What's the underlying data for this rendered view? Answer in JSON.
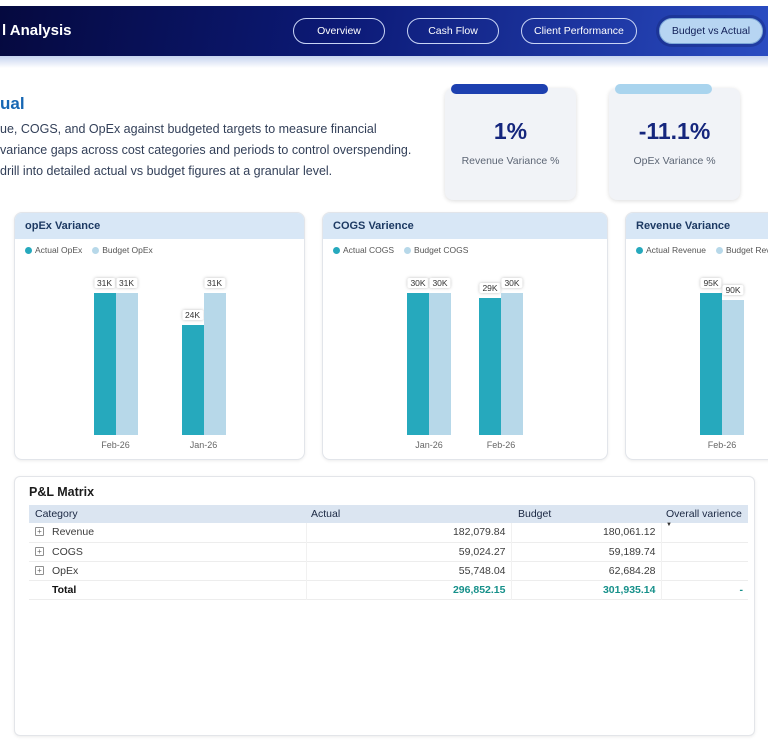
{
  "header": {
    "title": "l Analysis",
    "tabs": [
      {
        "label": "Overview",
        "active": false
      },
      {
        "label": "Cash Flow",
        "active": false
      },
      {
        "label": "Client Performance",
        "active": false
      },
      {
        "label": "Budget vs Actual",
        "active": true
      }
    ]
  },
  "intro": {
    "heading": "ual",
    "lines": [
      "ue, COGS, and OpEx against budgeted targets to measure financial",
      "variance gaps across cost categories and periods to control overspending.",
      "drill into detailed actual vs budget figures at a granular level."
    ]
  },
  "kpis": [
    {
      "value": "1%",
      "label": "Revenue Variance %",
      "accent": "#1d40b0"
    },
    {
      "value": "-11.1%",
      "label": "OpEx Variance %",
      "accent": "#a9d4ee"
    }
  ],
  "chart_data": [
    {
      "type": "bar",
      "title": "opEx Variance",
      "categories": [
        "Feb-26",
        "Jan-26"
      ],
      "series": [
        {
          "name": "Actual OpEx",
          "values": [
            31,
            24
          ]
        },
        {
          "name": "Budget OpEx",
          "values": [
            31,
            31
          ]
        }
      ],
      "unit": "K",
      "ylim": [
        0,
        31
      ],
      "colors": [
        "#26a9bd",
        "#b7d8e9"
      ],
      "legend_position": "top"
    },
    {
      "type": "bar",
      "title": "COGS Varience",
      "categories": [
        "Jan-26",
        "Feb-26"
      ],
      "series": [
        {
          "name": "Actual COGS",
          "values": [
            30,
            29
          ]
        },
        {
          "name": "Budget COGS",
          "values": [
            30,
            30
          ]
        }
      ],
      "unit": "K",
      "ylim": [
        0,
        30
      ],
      "colors": [
        "#26a9bd",
        "#b7d8e9"
      ],
      "legend_position": "top"
    },
    {
      "type": "bar",
      "title": "Revenue Variance",
      "categories": [
        "Feb-26"
      ],
      "series": [
        {
          "name": "Actual Revenue",
          "values": [
            95
          ]
        },
        {
          "name": "Budget Revenue",
          "values": [
            90
          ]
        }
      ],
      "unit": "K",
      "ylim": [
        0,
        95
      ],
      "colors": [
        "#26a9bd",
        "#b7d8e9"
      ],
      "legend_position": "top"
    }
  ],
  "pnl": {
    "title": "P&L Matrix",
    "columns": [
      "Category",
      "Actual",
      "Budget",
      "Overall varience"
    ],
    "rows": [
      {
        "category": "Revenue",
        "actual": "182,079.84",
        "budget": "180,061.12",
        "overall": ""
      },
      {
        "category": "COGS",
        "actual": "59,024.27",
        "budget": "59,189.74",
        "overall": ""
      },
      {
        "category": "OpEx",
        "actual": "55,748.04",
        "budget": "62,684.28",
        "overall": ""
      }
    ],
    "total": {
      "category": "Total",
      "actual": "296,852.15",
      "budget": "301,935.14",
      "overall": "-"
    },
    "total_color": "#16908a"
  }
}
